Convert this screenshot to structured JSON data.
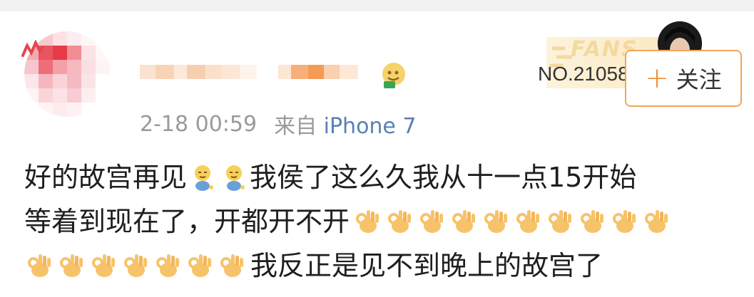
{
  "post": {
    "timestamp": "2-18 00:59",
    "source_label": "来自",
    "device": "iPhone 7",
    "fans_badge": {
      "word": "FANS",
      "number": "NO.21058"
    },
    "follow_label": "关注",
    "text_line1": "好的故宫再见",
    "text_line1b": "我侯了这么久我从十一点15开始",
    "text_line2": "等着到现在了，开都开不开",
    "text_line3": "我反正是见不到晚上的故宫了"
  },
  "icons": {
    "shy_emoji": "shy-face-emoji-icon",
    "ok_hand": "ok-hand-emoji-icon",
    "follow_plus": "plus-icon",
    "vip": "vip-badge-icon"
  },
  "colors": {
    "meta_gray": "#9a9a9a",
    "device_blue": "#5b7fb3",
    "follow_border": "#f1a65a",
    "accent_orange": "#f08a2e",
    "fans_gold": "#f3d9a0"
  }
}
